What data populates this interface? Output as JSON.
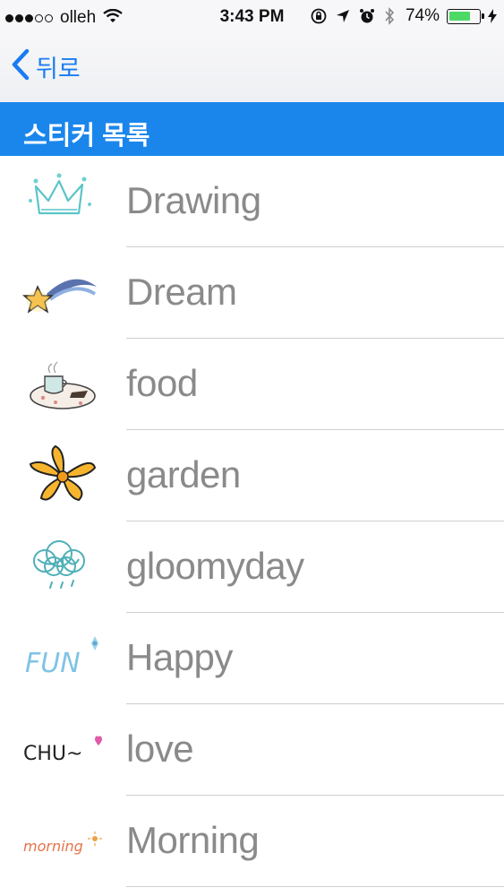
{
  "status_bar": {
    "carrier": "olleh",
    "time": "3:43 PM",
    "battery_percent": "74%",
    "battery_level": 0.74
  },
  "nav": {
    "back_label": "뒤로"
  },
  "header": {
    "title": "스티커 목록"
  },
  "stickers": [
    {
      "label": "Drawing",
      "icon": "crown-sticker-icon"
    },
    {
      "label": "Dream",
      "icon": "shooting-star-sticker-icon"
    },
    {
      "label": "food",
      "icon": "tea-plate-sticker-icon"
    },
    {
      "label": "garden",
      "icon": "flower-sticker-icon"
    },
    {
      "label": "gloomyday",
      "icon": "rain-cloud-sticker-icon"
    },
    {
      "label": "Happy",
      "icon": "fun-text-sticker-icon",
      "thumb_text": "FUN"
    },
    {
      "label": "love",
      "icon": "chu-text-sticker-icon",
      "thumb_text": "CHU~"
    },
    {
      "label": "Morning",
      "icon": "morning-text-sticker-icon",
      "thumb_text": "morning"
    }
  ],
  "colors": {
    "accent": "#1a86ec",
    "back_blue": "#1a7cf2",
    "label_gray": "#8a8a8a"
  }
}
